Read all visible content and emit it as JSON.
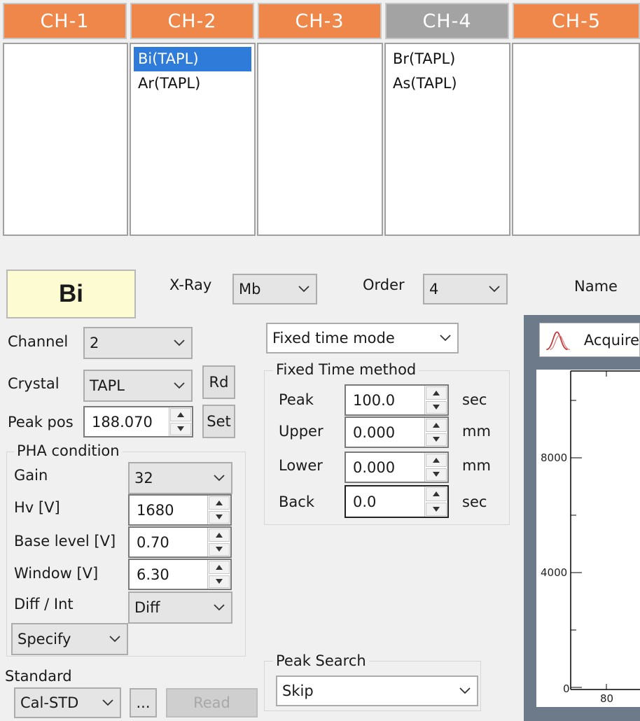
{
  "channels": {
    "tabs": [
      {
        "label": "CH-1",
        "items": []
      },
      {
        "label": "CH-2",
        "items": [
          "Bi(TAPL)",
          "Ar(TAPL)"
        ]
      },
      {
        "label": "CH-3",
        "items": []
      },
      {
        "label": "CH-4",
        "items": [
          "Br(TAPL)",
          "As(TAPL)"
        ]
      },
      {
        "label": "CH-5",
        "items": []
      }
    ],
    "active_tab": "CH-4",
    "selected_item": "Bi(TAPL)"
  },
  "element": {
    "symbol": "Bi"
  },
  "xray": {
    "label": "X-Ray",
    "value": "Mb"
  },
  "order": {
    "label": "Order",
    "value": "4"
  },
  "name": {
    "label": "Name"
  },
  "channel": {
    "label": "Channel",
    "value": "2"
  },
  "crystal": {
    "label": "Crystal",
    "value": "TAPL",
    "rd_button": "Rd"
  },
  "peak_pos": {
    "label": "Peak pos",
    "value": "188.070",
    "set_button": "Set"
  },
  "pha": {
    "title": "PHA condition",
    "gain": {
      "label": "Gain",
      "value": "32"
    },
    "hv": {
      "label": "Hv [V]",
      "value": "1680"
    },
    "base_level": {
      "label": "Base level [V]",
      "value": "0.70"
    },
    "window": {
      "label": "Window [V]",
      "value": "6.30"
    },
    "diff_int": {
      "label": "Diff / Int",
      "value": "Diff"
    },
    "specify": {
      "value": "Specify"
    }
  },
  "standard": {
    "label": "Standard",
    "value": "Cal-STD",
    "browse_button": "...",
    "read_button": "Read"
  },
  "mode": {
    "value": "Fixed time mode"
  },
  "fixed_time": {
    "title": "Fixed Time method",
    "rows": [
      {
        "label": "Peak",
        "value": "100.0",
        "unit": "sec"
      },
      {
        "label": "Upper",
        "value": "0.000",
        "unit": "mm"
      },
      {
        "label": "Lower",
        "value": "0.000",
        "unit": "mm"
      },
      {
        "label": "Back",
        "value": "0.0",
        "unit": "sec"
      }
    ]
  },
  "peak_search": {
    "title": "Peak Search",
    "value": "Skip"
  },
  "acquire": {
    "label": "Acquire",
    "icon": "peak-profile-icon"
  },
  "plot": {
    "y_ticks": [
      "8000",
      "4000",
      "0"
    ],
    "x_ticks": [
      "80"
    ]
  }
}
